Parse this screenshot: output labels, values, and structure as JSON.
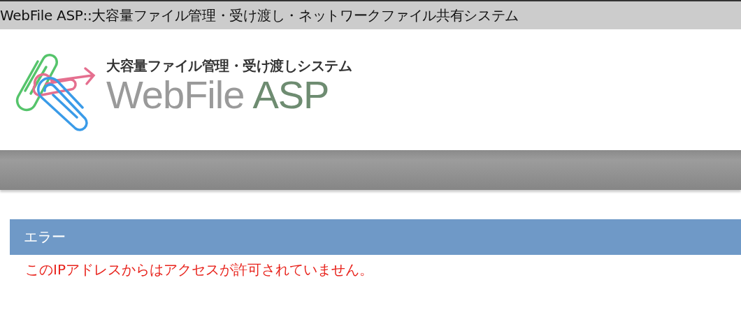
{
  "window": {
    "title": "WebFile ASP::大容量ファイル管理・受け渡し・ネットワークファイル共有システム"
  },
  "logo": {
    "tagline": "大容量ファイル管理・受け渡しシステム",
    "name": "WebFile",
    "suffix": "ASP"
  },
  "error": {
    "heading": "エラー",
    "message": "このIPアドレスからはアクセスが許可されていません。"
  }
}
